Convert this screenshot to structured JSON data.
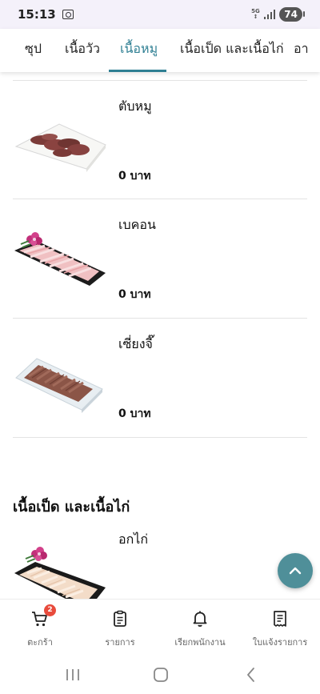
{
  "status_bar": {
    "time": "15:13",
    "network": "5G",
    "battery": "74"
  },
  "tabs": [
    {
      "label": "ซุป",
      "active": false
    },
    {
      "label": "เนื้อวัว",
      "active": false
    },
    {
      "label": "เนื้อหมู",
      "active": true
    },
    {
      "label": "เนื้อเป็ด และเนื้อไก่",
      "active": false
    },
    {
      "label": "อา",
      "active": false
    }
  ],
  "items": [
    {
      "name": "ตับหมู",
      "price": "0 บาท",
      "image": "pork-liver-photo"
    },
    {
      "name": "เบคอน",
      "price": "0 บาท",
      "image": "bacon-photo"
    },
    {
      "name": "เซี่ยงจี๊",
      "price": "0 บาท",
      "image": "sliced-meat-photo"
    }
  ],
  "section": {
    "title": "เนื้อเป็ด และเนื้อไก่",
    "items": [
      {
        "name": "อกไก่",
        "price": "",
        "image": "chicken-breast-photo"
      }
    ]
  },
  "bottom_nav": [
    {
      "label": "ตะกร้า",
      "icon": "cart-icon",
      "badge": "2"
    },
    {
      "label": "รายการ",
      "icon": "clipboard-icon"
    },
    {
      "label": "เรียกพนักงาน",
      "icon": "bell-icon"
    },
    {
      "label": "ใบแจ้งรายการ",
      "icon": "receipt-icon"
    }
  ],
  "colors": {
    "accent": "#2f7f93",
    "fab": "#4f8f99",
    "badge": "#e84b3c"
  }
}
